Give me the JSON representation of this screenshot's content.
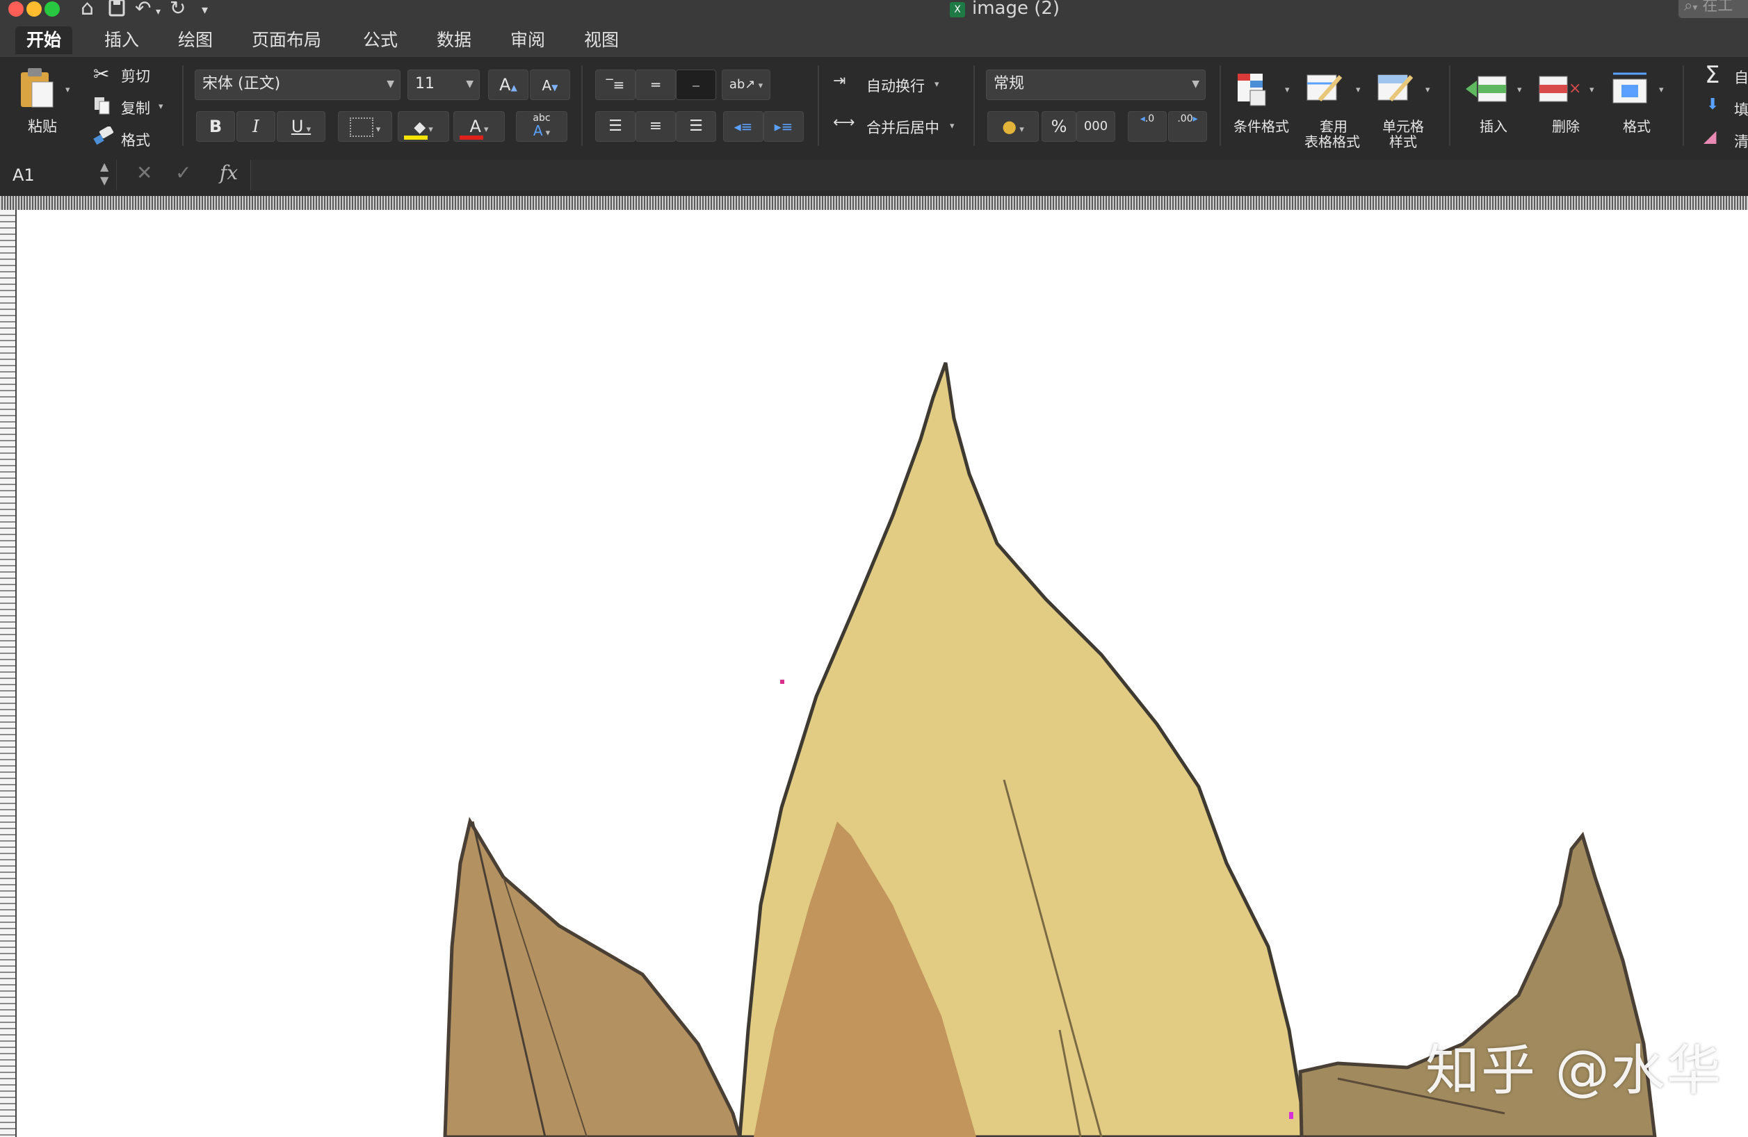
{
  "window": {
    "title": "image (2)",
    "file_badge": "X",
    "search_placeholder": "在工"
  },
  "colors": {
    "close": "#ff5f57",
    "minimize": "#febc2e",
    "zoom": "#28c840"
  },
  "tabs": [
    "开始",
    "插入",
    "绘图",
    "页面布局",
    "公式",
    "数据",
    "审阅",
    "视图"
  ],
  "clipboard": {
    "paste": "粘贴",
    "cut": "剪切",
    "copy": "复制",
    "format_painter": "格式"
  },
  "font": {
    "name": "宋体 (正文)",
    "size": "11",
    "bold": "B",
    "italic": "I",
    "underline": "U",
    "grow": "A",
    "shrink": "A",
    "color": "A",
    "phonetic": "abc"
  },
  "alignment": {
    "wrap_text": "自动换行",
    "merge_center": "合并后居中"
  },
  "number": {
    "format": "常规",
    "percent": "%",
    "thousands": "000",
    "inc_decimal": ".0",
    "dec_decimal": ".00"
  },
  "styles": {
    "conditional": "条件格式",
    "table_line1": "套用",
    "table_line2": "表格格式",
    "cell_line1": "单元格",
    "cell_line2": "样式"
  },
  "cells": {
    "insert": "插入",
    "delete": "删除",
    "format": "格式"
  },
  "editing": {
    "autosum": "自",
    "fill": "填",
    "clear": "清"
  },
  "formula_bar": {
    "name_box": "A1",
    "fx": "fx"
  },
  "watermark": "知乎 @水华"
}
